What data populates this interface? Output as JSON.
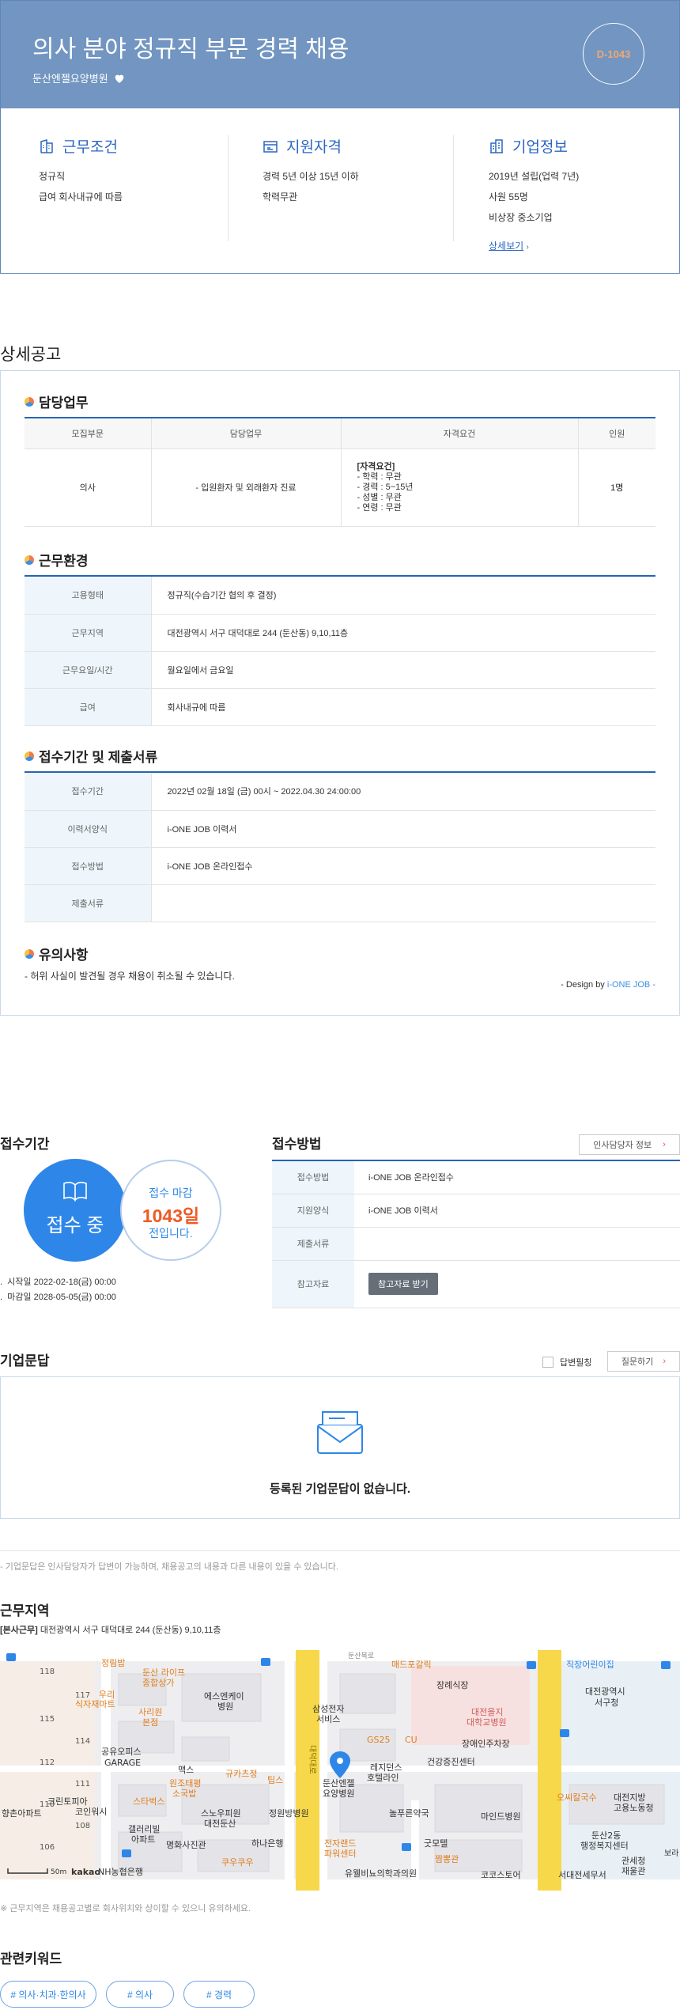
{
  "header": {
    "title": "의사 분야 정규직 부문 경력 채용",
    "company": "둔산엔젤요양병원",
    "dday": "D-1043"
  },
  "conditions": {
    "work": {
      "title": "근무조건",
      "lines": [
        "정규직",
        "급여 회사내규에 따름"
      ]
    },
    "qualification": {
      "title": "지원자격",
      "lines": [
        "경력 5년 이상 15년 이하",
        "학력무관"
      ]
    },
    "company": {
      "title": "기업정보",
      "lines": [
        "2019년 설립(업력 7년)",
        "사원 55명",
        "비상장 중소기업"
      ],
      "more": "상세보기"
    }
  },
  "detail": {
    "title": "상세공고",
    "duty": {
      "title": "담당업무",
      "headers": [
        "모집부문",
        "담당업무",
        "자격요건",
        "인원"
      ],
      "row": {
        "division": "의사",
        "task": "- 입원환자 및 외래환자 진료",
        "qual_title": "[자격요건]",
        "qual_lines": [
          "- 학력 : 무관",
          "- 경력 : 5~15년",
          "- 성별 : 무관",
          "- 연령 : 무관"
        ],
        "count": "1명"
      }
    },
    "env": {
      "title": "근무환경",
      "rows": [
        {
          "label": "고용형태",
          "value": "정규직(수습기간 협의 후 결정)"
        },
        {
          "label": "근무지역",
          "value": "대전광역시 서구 대덕대로 244 (둔산동) 9,10,11층"
        },
        {
          "label": "근무요일/시간",
          "value": "월요일에서 금요일"
        },
        {
          "label": "급여",
          "value": "회사내규에 따름"
        }
      ]
    },
    "apply": {
      "title": "접수기간 및 제출서류",
      "rows": [
        {
          "label": "접수기간",
          "value": "2022년 02월 18일 (금) 00시 ~ 2022.04.30 24:00:00"
        },
        {
          "label": "이력서양식",
          "value": "i-ONE JOB 이력서"
        },
        {
          "label": "접수방법",
          "value": "i-ONE JOB 온라인접수"
        },
        {
          "label": "제출서류",
          "value": ""
        }
      ]
    },
    "caution": {
      "title": "유의사항",
      "text": "- 허위 사실이 발견될 경우 채용이 취소될 수 있습니다."
    },
    "design_prefix": "- Design by ",
    "design_brand": "i-ONE JOB -"
  },
  "period": {
    "title": "접수기간",
    "status": "접수 중",
    "deadline_label": "접수 마감",
    "deadline_days": "1043일",
    "deadline_suffix": "전입니다.",
    "start": "시작일 2022-02-18(금) 00:00",
    "end": "마감일 2028-05-05(금) 00:00"
  },
  "method": {
    "title": "접수방법",
    "hr_button": "인사담당자 정보",
    "rows": [
      {
        "label": "접수방법",
        "value": "i-ONE JOB 온라인접수"
      },
      {
        "label": "지원양식",
        "value": "i-ONE JOB 이력서"
      },
      {
        "label": "제출서류",
        "value": ""
      },
      {
        "label": "참고자료",
        "value": ""
      }
    ],
    "file_button": "참고자료 받기"
  },
  "qa": {
    "title": "기업문답",
    "check_label": "답변필칭",
    "ask_button": "질문하기",
    "empty": "등록된 기업문답이 없습니다.",
    "note": "- 기업문답은 인사담당자가 답변이 가능하며, 채용공고의 내용과 다른 내용이 있을 수 있습니다."
  },
  "location": {
    "title": "근무지역",
    "tag": "[본사근무]",
    "address": "대전광역시 서구 대덕대로 244 (둔산동) 9,10,11층",
    "note": "※ 근무지역은 채용공고별로 회사위치와 상이할 수 있으니 유의하세요.",
    "map": {
      "scale": "50m",
      "brand": "kakao",
      "labels": {
        "l1": "정림밥",
        "l2": "둔산 라이프",
        "l3": "종합상가",
        "l4": "우리",
        "l5": "식자재마트",
        "l6": "사리원",
        "l7": "본점",
        "l8": "에스엔케이",
        "l9": "병원",
        "l10": "삼성전자",
        "l11": "서비스",
        "l12": "매드포갈릭",
        "l13": "장례식장",
        "l14": "대전을지",
        "l15": "대학교병원",
        "l16": "직장어린이집",
        "l17": "대전광역시",
        "l18": "서구청",
        "l19": "공유오피스",
        "l20": "GARAGE",
        "l21": "GS25",
        "l22": "CU",
        "l23": "장애인주차장",
        "l24": "레지던스",
        "l25": "호텔라인",
        "l26": "건강증진센터",
        "l27": "맥스",
        "l28": "원조태평",
        "l29": "소국밥",
        "l30": "규카츠정",
        "l31": "팁스",
        "l32": "둔산엔젤",
        "l33": "요양병원",
        "l34": "스타벅스",
        "l35": "크린토피아",
        "l36": "코인워시",
        "l37": "스노우피원",
        "l38": "대전둔산",
        "l39": "정원방병원",
        "l40": "놀푸른약국",
        "l41": "마인드병원",
        "l42": "오씨칼국수",
        "l43": "대전지방",
        "l44": "고용노동청",
        "l45": "갤러리빌",
        "l46": "아파트",
        "l47": "명화사진관",
        "l48": "하나은행",
        "l49": "전자랜드",
        "l50": "파워센터",
        "l51": "굿모텔",
        "l52": "둔산2동",
        "l53": "행정복지센터",
        "l54": "향촌아파트",
        "l55": "NH농협은행",
        "l56": "쿠우쿠우",
        "l57": "짬뽕관",
        "l58": "유웰비뇨의학과의원",
        "l59": "코코스토어",
        "l60": "서대전세무서",
        "l61": "관세청",
        "l62": "재울관",
        "l63": "대덕대로",
        "l64": "둔산북로",
        "l65": "보라"
      },
      "numbers": [
        "118",
        "117",
        "115",
        "114",
        "112",
        "111",
        "110",
        "108",
        "106"
      ]
    }
  },
  "keywords": {
    "title": "관련키워드",
    "items": [
      "# 의사·치과·한의사",
      "# 의사",
      "# 경력"
    ]
  },
  "colors": {
    "hero_bg": "#7295c1",
    "accent_blue": "#2b66c2",
    "dday_orange": "#f0a874",
    "deadline_orange": "#ef5a24",
    "map_highway_yellow": "#f7d84a"
  }
}
